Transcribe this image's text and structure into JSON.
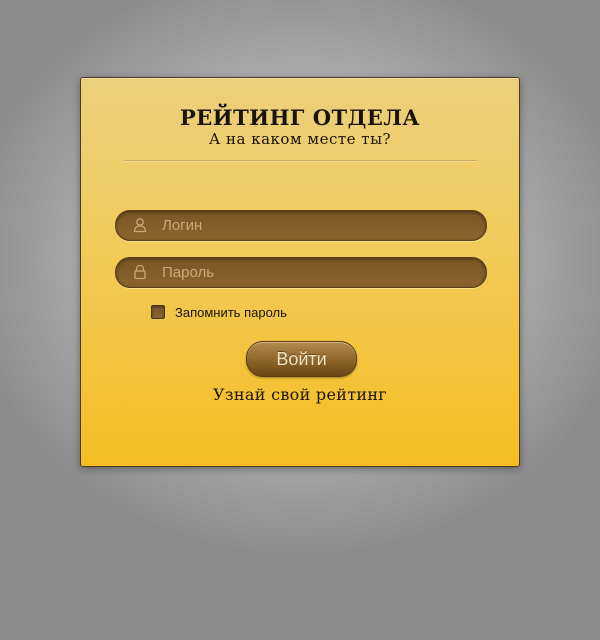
{
  "header": {
    "title": "РЕЙТИНГ ОТДЕЛА",
    "subtitle": "А на каком месте ты?"
  },
  "form": {
    "login": {
      "placeholder": "Логин",
      "value": "",
      "icon": "user-icon"
    },
    "password": {
      "placeholder": "Пароль",
      "value": "",
      "icon": "lock-icon"
    },
    "remember": {
      "label": "Запомнить пароль",
      "checked": false
    },
    "submit_label": "Войти",
    "rating_link": "Узнай свой рейтинг"
  },
  "colors": {
    "card_top": "#ebd07c",
    "card_bottom": "#f5bd22",
    "field": "#7d5827",
    "text": "#1a130a"
  }
}
